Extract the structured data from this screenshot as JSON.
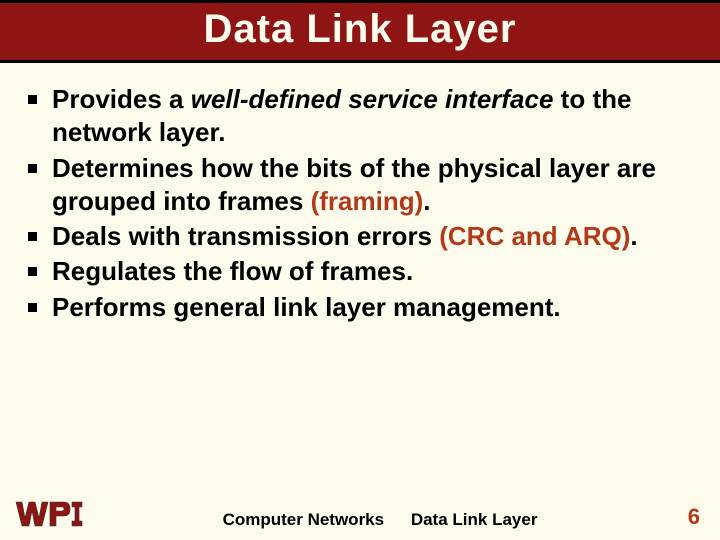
{
  "title": "Data Link Layer",
  "bullets": [
    {
      "segments": [
        {
          "text": "Provides a "
        },
        {
          "text": "well-defined service interface",
          "cls": "emph-italic"
        },
        {
          "text": " to the network layer."
        }
      ]
    },
    {
      "segments": [
        {
          "text": "Determines how the bits of the physical layer are grouped into frames "
        },
        {
          "text": "(framing)",
          "cls": "accent"
        },
        {
          "text": "."
        }
      ]
    },
    {
      "segments": [
        {
          "text": "Deals with transmission errors "
        },
        {
          "text": "(CRC and ARQ)",
          "cls": "accent"
        },
        {
          "text": "."
        }
      ]
    },
    {
      "segments": [
        {
          "text": "Regulates the flow of frames."
        }
      ]
    },
    {
      "segments": [
        {
          "text": "Performs general link layer management."
        }
      ]
    }
  ],
  "footer": {
    "left": "Computer Networks",
    "right": "Data Link Layer",
    "page": "6"
  },
  "logo": {
    "text": "WPI"
  }
}
